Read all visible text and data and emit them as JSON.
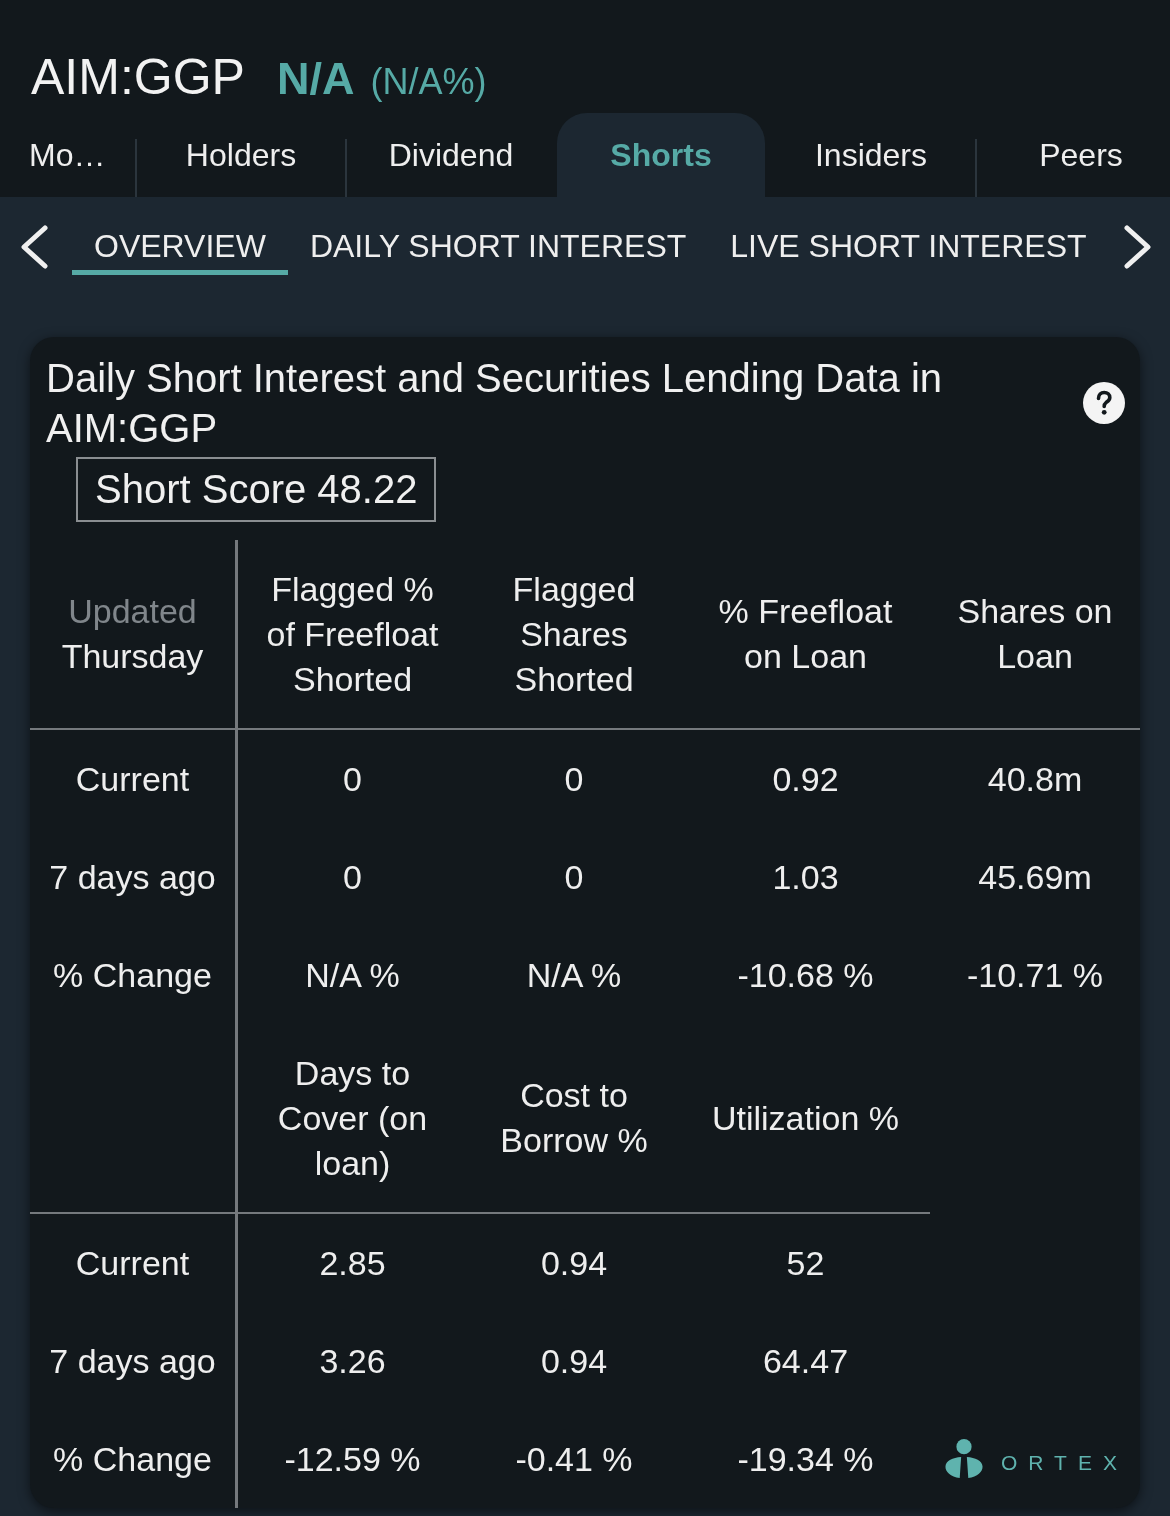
{
  "header": {
    "symbol": "AIM:GGP",
    "price": "N/A",
    "change": "(N/A%)"
  },
  "tabs": [
    {
      "label": "Mo…",
      "selected": false
    },
    {
      "label": "Holders",
      "selected": false
    },
    {
      "label": "Dividend",
      "selected": false
    },
    {
      "label": "Shorts",
      "selected": true
    },
    {
      "label": "Insiders",
      "selected": false
    },
    {
      "label": "Peers",
      "selected": false
    }
  ],
  "subtabs": [
    {
      "label": "OVERVIEW",
      "selected": true
    },
    {
      "label": "DAILY SHORT INTEREST",
      "selected": false
    },
    {
      "label": "LIVE SHORT INTEREST",
      "selected": false
    }
  ],
  "card": {
    "title": "Daily Short Interest and Securities Lending Data in AIM:GGP",
    "short_score": "Short Score 48.22",
    "sections": [
      {
        "updated_label": "Updated",
        "updated_day": "Thursday",
        "columns": [
          "Flagged % of Freefloat Shorted",
          "Flagged Shares Shorted",
          "% Freefloat on Loan",
          "Shares on Loan"
        ],
        "rows": [
          {
            "label": "Current",
            "values": [
              "0",
              "0",
              "0.92",
              "40.8m"
            ]
          },
          {
            "label": "7 days ago",
            "values": [
              "0",
              "0",
              "1.03",
              "45.69m"
            ]
          },
          {
            "label": "% Change",
            "values": [
              "N/A %",
              "N/A %",
              "-10.68 %",
              "-10.71 %"
            ]
          }
        ]
      },
      {
        "columns": [
          "Days to Cover (on loan)",
          "Cost to Borrow %",
          "Utilization %"
        ],
        "rows": [
          {
            "label": "Current",
            "values": [
              "2.85",
              "0.94",
              "52"
            ]
          },
          {
            "label": "7 days ago",
            "values": [
              "3.26",
              "0.94",
              "64.47"
            ]
          },
          {
            "label": "% Change",
            "values": [
              "-12.59 %",
              "-0.41 %",
              "-19.34 %"
            ]
          }
        ]
      }
    ],
    "brand": "ORTEX"
  }
}
